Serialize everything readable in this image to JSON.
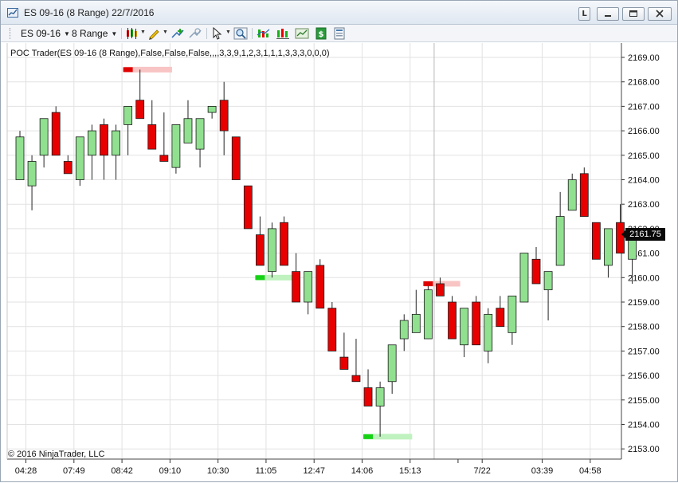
{
  "window": {
    "title": "ES 09-16 (8 Range)  22/7/2016",
    "link_label": "L"
  },
  "toolbar": {
    "instrument": "ES 09-16",
    "interval": "8 Range",
    "icons": [
      "candlestick-style-icon",
      "pencil-draw-icon",
      "add-indicator-icon",
      "strategy-icon",
      "pointer-icon",
      "zoom-icon",
      "indicators-icon",
      "chart-style-icon",
      "data-series-icon",
      "money-icon",
      "properties-icon"
    ]
  },
  "indicator_label": "POC Trader(ES 09-16 (8 Range),False,False,False,,,,3,3,9,1,2,3,1,1,1,3,3,3,0,0,0)",
  "copyright": "© 2016 NinjaTrader, LLC",
  "last_price": "2161.75",
  "colors": {
    "up_body": "#90e090",
    "down_body": "#e80000",
    "grid": "#e2e2e2",
    "wick": "#222222",
    "poc_up_marker": "#16d216",
    "poc_down_marker": "#e00000",
    "poc_up_zone": "#bff2bf",
    "poc_down_zone": "#f8c4c4"
  },
  "chart_data": {
    "type": "candlestick",
    "yaxis": {
      "ylim": [
        2152.7,
        2169.25
      ],
      "ticks": [
        "2169.00",
        "2168.00",
        "2167.00",
        "2166.00",
        "2165.00",
        "2164.00",
        "2163.00",
        "2162.00",
        "2161.00",
        "2160.00",
        "2159.00",
        "2158.00",
        "2157.00",
        "2156.00",
        "2155.00",
        "2154.00",
        "2153.00"
      ],
      "tick_values": [
        2169,
        2168,
        2167,
        2166,
        2165,
        2164,
        2163,
        2162,
        2161,
        2160,
        2159,
        2158,
        2157,
        2156,
        2155,
        2154,
        2153
      ]
    },
    "xaxis": {
      "labels": [
        {
          "text": "04:28",
          "bar": 0.5
        },
        {
          "text": "07:49",
          "bar": 4.5
        },
        {
          "text": "08:42",
          "bar": 8.5
        },
        {
          "text": "09:10",
          "bar": 12.5
        },
        {
          "text": "10:30",
          "bar": 16.5
        },
        {
          "text": "11:05",
          "bar": 20.5
        },
        {
          "text": "12:47",
          "bar": 24.5
        },
        {
          "text": "14:06",
          "bar": 28.5
        },
        {
          "text": "15:13",
          "bar": 32.5
        },
        {
          "text": "7/22",
          "bar": 38.5
        },
        {
          "text": "03:39",
          "bar": 43.5
        },
        {
          "text": "04:58",
          "bar": 47.5
        }
      ],
      "session_break_bar": 34.5
    },
    "bars": [
      {
        "o": 2164.0,
        "h": 2166.0,
        "c": 2165.75,
        "l": 2164.0
      },
      {
        "o": 2163.75,
        "h": 2165.0,
        "c": 2164.75,
        "l": 2162.75
      },
      {
        "o": 2165.0,
        "h": 2166.0,
        "c": 2166.5,
        "l": 2164.5
      },
      {
        "o": 2166.75,
        "h": 2167.0,
        "c": 2165.0,
        "l": 2165.0
      },
      {
        "o": 2164.75,
        "h": 2165.0,
        "c": 2164.25,
        "l": 2164.25
      },
      {
        "o": 2164.0,
        "h": 2165.75,
        "c": 2165.75,
        "l": 2163.75
      },
      {
        "o": 2165.0,
        "h": 2166.25,
        "c": 2166.0,
        "l": 2164.0
      },
      {
        "o": 2166.25,
        "h": 2166.5,
        "c": 2165.0,
        "l": 2164.0
      },
      {
        "o": 2165.0,
        "h": 2166.25,
        "c": 2166.0,
        "l": 2164.0
      },
      {
        "o": 2166.25,
        "h": 2166.75,
        "c": 2167.0,
        "l": 2165.0
      },
      {
        "o": 2167.25,
        "h": 2168.5,
        "c": 2166.5,
        "l": 2166.5
      },
      {
        "o": 2166.25,
        "h": 2167.25,
        "c": 2165.25,
        "l": 2165.25
      },
      {
        "o": 2165.0,
        "h": 2166.75,
        "c": 2164.75,
        "l": 2164.75
      },
      {
        "o": 2164.5,
        "h": 2166.25,
        "c": 2166.25,
        "l": 2164.25
      },
      {
        "o": 2165.5,
        "h": 2167.25,
        "c": 2166.5,
        "l": 2165.5
      },
      {
        "o": 2165.25,
        "h": 2166.5,
        "c": 2166.5,
        "l": 2164.5
      },
      {
        "o": 2166.75,
        "h": 2167.0,
        "c": 2167.0,
        "l": 2166.5
      },
      {
        "o": 2167.25,
        "h": 2168.0,
        "c": 2166.0,
        "l": 2165.0
      },
      {
        "o": 2165.75,
        "h": 2165.75,
        "c": 2164.0,
        "l": 2164.0
      },
      {
        "o": 2163.75,
        "h": 2163.75,
        "c": 2162.0,
        "l": 2162.0
      },
      {
        "o": 2161.75,
        "h": 2162.5,
        "c": 2160.5,
        "l": 2160.5
      },
      {
        "o": 2160.25,
        "h": 2162.25,
        "c": 2162.0,
        "l": 2160.0
      },
      {
        "o": 2162.25,
        "h": 2162.5,
        "c": 2160.5,
        "l": 2160.5
      },
      {
        "o": 2160.25,
        "h": 2161.0,
        "c": 2159.0,
        "l": 2159.0
      },
      {
        "o": 2159.0,
        "h": 2160.25,
        "c": 2160.25,
        "l": 2158.5
      },
      {
        "o": 2160.5,
        "h": 2160.75,
        "c": 2158.75,
        "l": 2158.75
      },
      {
        "o": 2158.75,
        "h": 2159.0,
        "c": 2157.0,
        "l": 2157.0
      },
      {
        "o": 2156.75,
        "h": 2157.75,
        "c": 2156.25,
        "l": 2156.25
      },
      {
        "o": 2156.0,
        "h": 2157.5,
        "c": 2155.75,
        "l": 2155.75
      },
      {
        "o": 2155.5,
        "h": 2156.25,
        "c": 2154.75,
        "l": 2154.75
      },
      {
        "o": 2154.75,
        "h": 2155.75,
        "c": 2155.5,
        "l": 2153.5
      },
      {
        "o": 2155.75,
        "h": 2157.25,
        "c": 2157.25,
        "l": 2155.25
      },
      {
        "o": 2157.5,
        "h": 2158.5,
        "c": 2158.25,
        "l": 2157.0
      },
      {
        "o": 2157.75,
        "h": 2159.5,
        "c": 2158.5,
        "l": 2157.75
      },
      {
        "o": 2157.5,
        "h": 2159.75,
        "c": 2159.5,
        "l": 2157.5
      },
      {
        "o": 2159.75,
        "h": 2160.0,
        "c": 2159.25,
        "l": 2159.25
      },
      {
        "o": 2159.0,
        "h": 2159.25,
        "c": 2157.5,
        "l": 2157.5
      },
      {
        "o": 2157.25,
        "h": 2158.75,
        "c": 2158.75,
        "l": 2156.75
      },
      {
        "o": 2159.0,
        "h": 2159.25,
        "c": 2157.25,
        "l": 2157.25
      },
      {
        "o": 2157.0,
        "h": 2158.75,
        "c": 2158.5,
        "l": 2156.5
      },
      {
        "o": 2158.75,
        "h": 2159.25,
        "c": 2158.0,
        "l": 2158.0
      },
      {
        "o": 2157.75,
        "h": 2159.25,
        "c": 2159.25,
        "l": 2157.25
      },
      {
        "o": 2159.0,
        "h": 2161.0,
        "c": 2161.0,
        "l": 2159.0
      },
      {
        "o": 2160.75,
        "h": 2161.25,
        "c": 2159.75,
        "l": 2159.75
      },
      {
        "o": 2159.5,
        "h": 2160.25,
        "c": 2160.25,
        "l": 2158.25
      },
      {
        "o": 2160.5,
        "h": 2163.5,
        "c": 2162.5,
        "l": 2160.5
      },
      {
        "o": 2162.75,
        "h": 2164.25,
        "c": 2164.0,
        "l": 2162.75
      },
      {
        "o": 2164.25,
        "h": 2164.5,
        "c": 2162.5,
        "l": 2162.5
      },
      {
        "o": 2162.25,
        "h": 2162.25,
        "c": 2160.75,
        "l": 2160.75
      },
      {
        "o": 2160.5,
        "h": 2162.0,
        "c": 2162.0,
        "l": 2160.0
      },
      {
        "o": 2162.25,
        "h": 2163.0,
        "c": 2161.0,
        "l": 2161.0
      },
      {
        "o": 2160.75,
        "h": 2161.75,
        "c": 2161.75,
        "l": 2159.75
      }
    ],
    "poc_markers": [
      {
        "bar": 9,
        "price": 2168.5,
        "kind": "down",
        "zone_bars": 4
      },
      {
        "bar": 20,
        "price": 2160.0,
        "kind": "up",
        "zone_bars": 3
      },
      {
        "bar": 29,
        "price": 2153.5,
        "kind": "up",
        "zone_bars": 4
      },
      {
        "bar": 34,
        "price": 2159.75,
        "kind": "down",
        "zone_bars": 3
      }
    ]
  }
}
